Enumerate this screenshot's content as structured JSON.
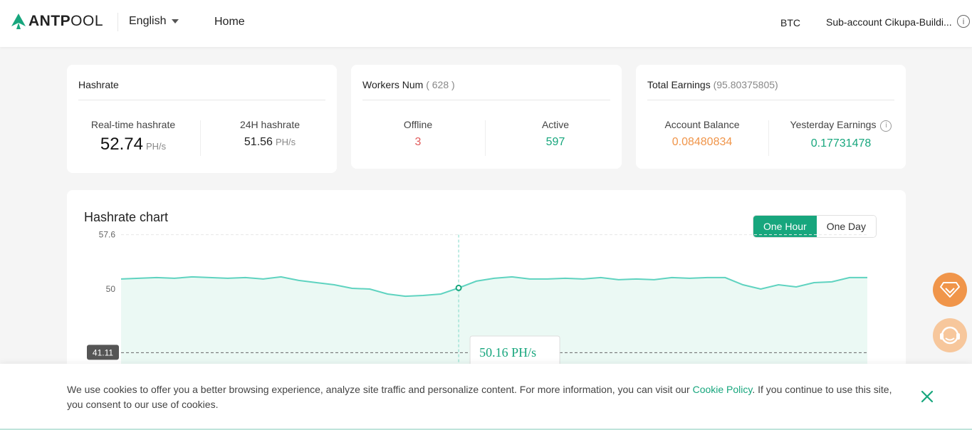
{
  "header": {
    "logo_bold": "ANTP",
    "logo_thin": "OOL",
    "language": "English",
    "home": "Home",
    "coin": "BTC",
    "subaccount": "Sub-account Cikupa-Buildi...",
    "info_glyph": "i"
  },
  "hashrate_card": {
    "title": "Hashrate",
    "realtime_label": "Real-time hashrate",
    "realtime_value": "52.74",
    "realtime_unit": "PH/s",
    "h24_label": "24H hashrate",
    "h24_value": "51.56",
    "h24_unit": "PH/s"
  },
  "workers_card": {
    "title": "Workers Num",
    "total": "( 628 )",
    "offline_label": "Offline",
    "offline_value": "3",
    "active_label": "Active",
    "active_value": "597"
  },
  "earnings_card": {
    "title": "Total Earnings",
    "total": "(95.80375805)",
    "balance_label": "Account Balance",
    "balance_value": "0.08480834",
    "yesterday_label": "Yesterday Earnings",
    "yesterday_value": "0.17731478",
    "info_glyph": "i"
  },
  "chart": {
    "title": "Hashrate chart",
    "toggle_hour": "One Hour",
    "toggle_day": "One Day",
    "tooltip_value": "50.16 PH/s",
    "avg_label": "41.11"
  },
  "chart_data": {
    "type": "area",
    "title": "Hashrate chart",
    "ylabel": "",
    "yticks": [
      "57.6",
      "50",
      "30"
    ],
    "reference_line": 41.11,
    "ylim": [
      30,
      57.6
    ],
    "series": [
      {
        "values": [
          51.4,
          51.5,
          51.6,
          51.5,
          51.7,
          51.6,
          51.5,
          51.6,
          51.4,
          51.7,
          51.2,
          50.9,
          50.6,
          50.1,
          50.0,
          49.3,
          49.0,
          49.1,
          49.3,
          50.16,
          51.1,
          51.5,
          51.7,
          51.4,
          51.4,
          51.5,
          51.4,
          51.6,
          51.3,
          51.4,
          51.3,
          51.6,
          51.5,
          51.6,
          51.6,
          50.6,
          50.0,
          50.6,
          50.3,
          50.9,
          51.0,
          51.6,
          51.6
        ]
      }
    ],
    "tooltip": {
      "index": 19,
      "value": "50.16 PH/s"
    },
    "colors": {
      "line": "#5fd3c0",
      "fill": "#e6f8f1"
    }
  },
  "float_buttons": {
    "first": "diamond-icon",
    "second": "support-icon"
  },
  "cookie": {
    "text_before": "We use cookies to offer you a better browsing experience, analyze site traffic and personalize content. For more information, you can visit our ",
    "link": "Cookie Policy",
    "text_after": ". If you continue to use this site, you consent to our use of cookies."
  },
  "colors": {
    "brand_green": "#17a67d",
    "orange": "#f0954a",
    "red": "#e15b5b"
  }
}
